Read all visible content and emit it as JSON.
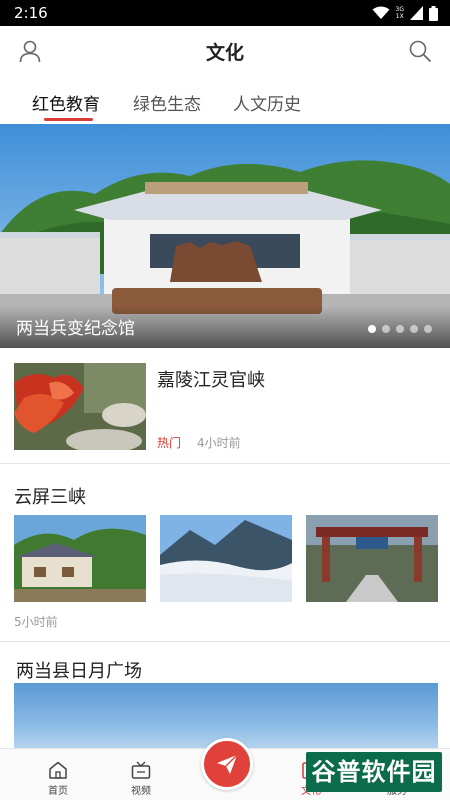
{
  "status_bar": {
    "time": "2:16",
    "net_top": "3G",
    "net_bottom": "1X"
  },
  "header": {
    "title": "文化"
  },
  "tabs": [
    {
      "label": "红色教育",
      "active": true
    },
    {
      "label": "绿色生态",
      "active": false
    },
    {
      "label": "人文历史",
      "active": false
    }
  ],
  "banner": {
    "caption": "两当兵变纪念馆",
    "slide_count": 5,
    "active_slide": 1
  },
  "articles": [
    {
      "title": "嘉陵江灵官峡",
      "tag": "热门",
      "time": "4小时前"
    },
    {
      "title": "云屏三峡",
      "time": "5小时前"
    },
    {
      "title": "两当县日月广场"
    }
  ],
  "bottom_nav": {
    "home": "首页",
    "video": "视频",
    "culture": "文化",
    "service": "服务",
    "active": "culture"
  },
  "watermark": "谷普软件园",
  "colors": {
    "accent": "#d83a35",
    "fab": "#e0413b",
    "watermark": "#0c6b4a"
  },
  "icons": [
    "user-icon",
    "search-icon",
    "home-icon",
    "tv-icon",
    "paper-plane-icon",
    "wifi-icon",
    "signal-icon",
    "battery-icon"
  ]
}
